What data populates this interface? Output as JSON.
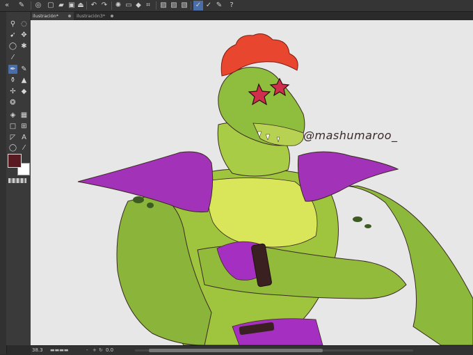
{
  "toolbar": {
    "buttons": [
      "menu",
      "new-file",
      "open-file",
      "save-file",
      "export",
      "undo",
      "redo",
      "clear",
      "fill",
      "transform",
      "select-all",
      "deselect",
      "invert",
      "stroke-1",
      "stroke-2",
      "stroke-3",
      "help"
    ]
  },
  "tabs": [
    {
      "label": "ilustración*",
      "active": true
    },
    {
      "label": "ilustración3*",
      "active": false
    }
  ],
  "colors": {
    "foreground": "#5a1a22",
    "background": "#ffffff"
  },
  "canvas": {
    "watermark": "@mashumaroo_"
  },
  "status": {
    "zoom": "38.3",
    "angle": "0.0"
  }
}
